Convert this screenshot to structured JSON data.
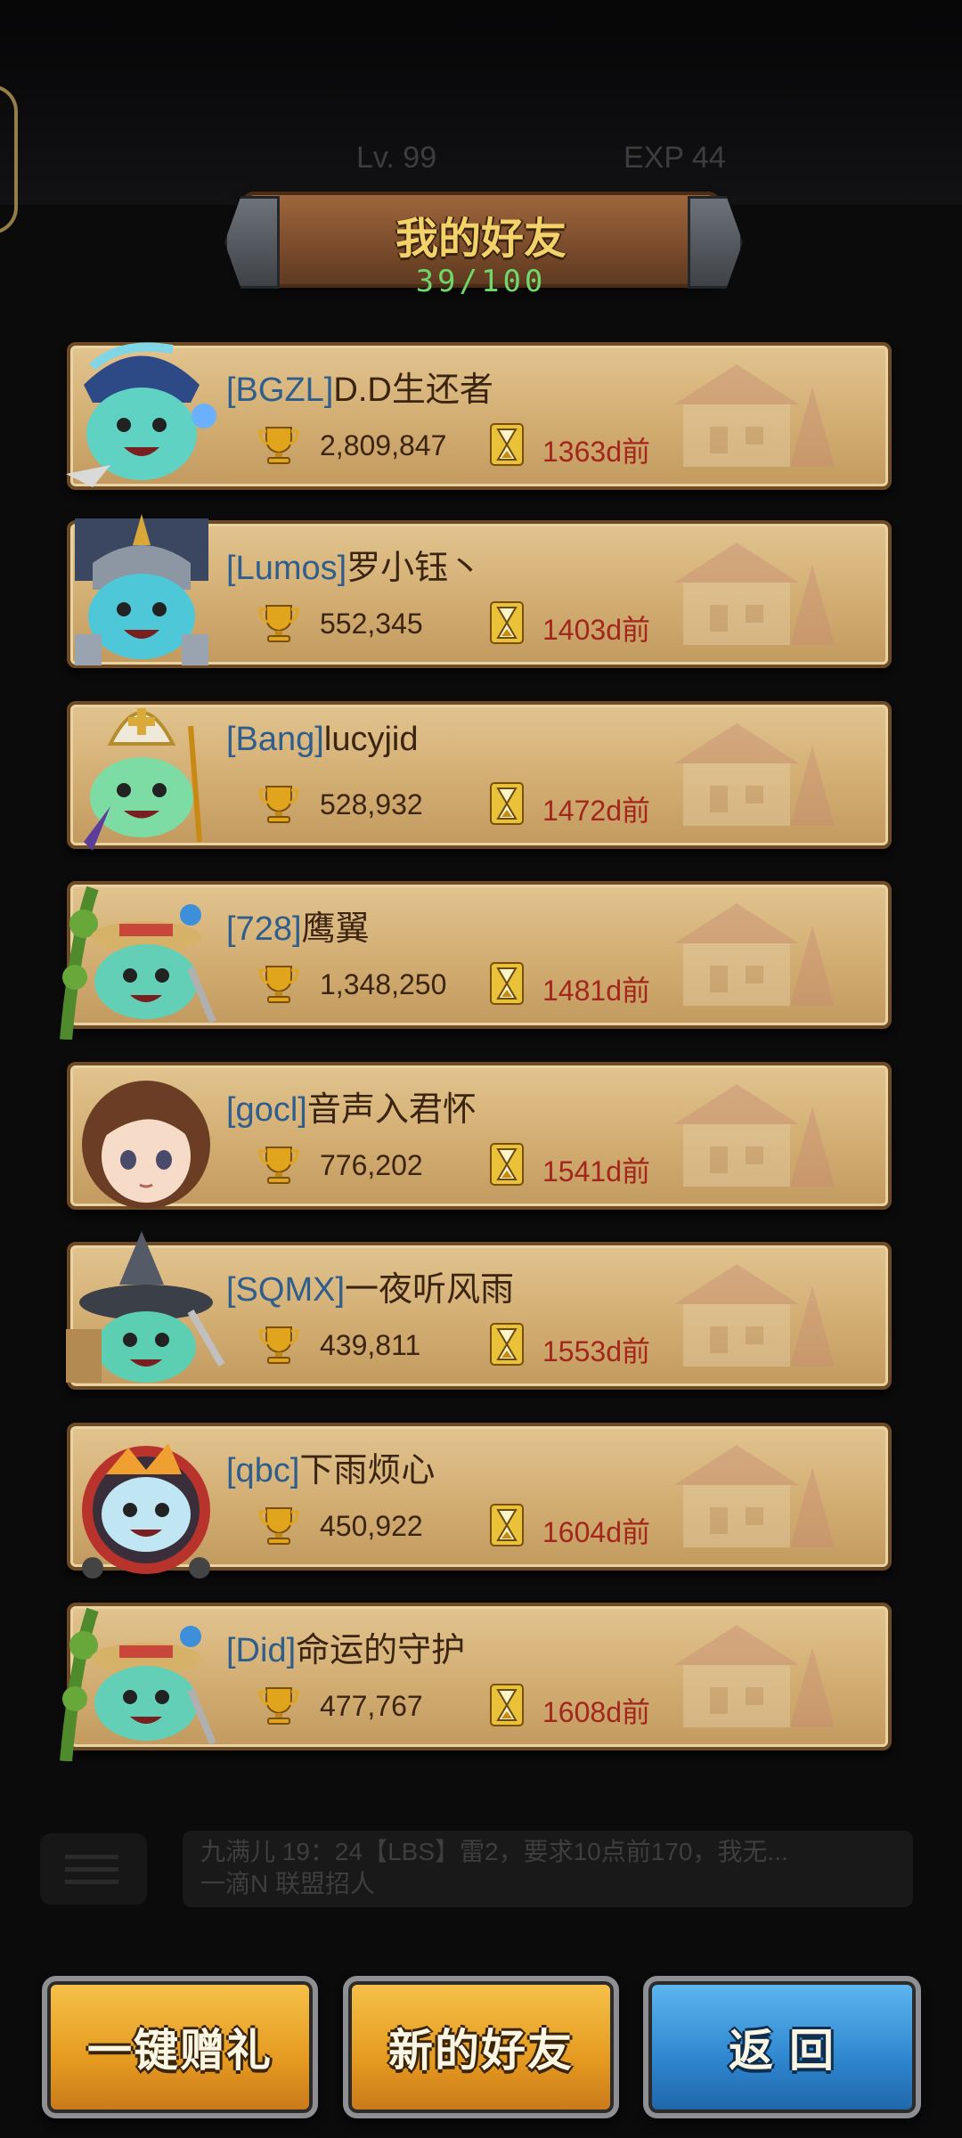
{
  "background_info": {
    "level_text": "Lv. 99",
    "exp_text": "EXP 44"
  },
  "header": {
    "title": "我的好友",
    "count": "39/100"
  },
  "friends": [
    {
      "tag": "[BGZL]",
      "name": "D.D生还者",
      "score": "2,809,847",
      "last_seen": "1363d前",
      "avatar": "mage-slime-avatar"
    },
    {
      "tag": "[Lumos]",
      "name": "罗小钰丶",
      "score": "552,345",
      "last_seen": "1403d前",
      "avatar": "knight-slime-avatar"
    },
    {
      "tag": "[Bang]",
      "name": "lucyjid",
      "score": "528,932",
      "last_seen": "1472d前",
      "avatar": "priest-slime-avatar"
    },
    {
      "tag": "[728]",
      "name": "鹰翼",
      "score": "1,348,250",
      "last_seen": "1481d前",
      "avatar": "gardener-slime-avatar"
    },
    {
      "tag": "[gocl]",
      "name": "音声入君怀",
      "score": "776,202",
      "last_seen": "1541d前",
      "avatar": "girl-avatar"
    },
    {
      "tag": "[SQMX]",
      "name": "一夜听风雨",
      "score": "439,811",
      "last_seen": "1553d前",
      "avatar": "witch-slime-avatar"
    },
    {
      "tag": "[qbc]",
      "name": "下雨烦心",
      "score": "450,922",
      "last_seen": "1604d前",
      "avatar": "gumball-slime-avatar"
    },
    {
      "tag": "[Did]",
      "name": "命运的守护",
      "score": "477,767",
      "last_seen": "1608d前",
      "avatar": "gardener-slime-avatar"
    }
  ],
  "chat": {
    "line1": "九满儿 19：24【LBS】雷2，要求10点前170，我无...",
    "line2": "一滴N 联盟招人"
  },
  "buttons": {
    "gift_all": "一键赠礼",
    "new_friends": "新的好友",
    "back": "返 回"
  },
  "colors": {
    "gold_button": "#e59a20",
    "blue_button": "#2e86cf",
    "last_seen": "#a2261c",
    "count": "#6fd86a"
  }
}
